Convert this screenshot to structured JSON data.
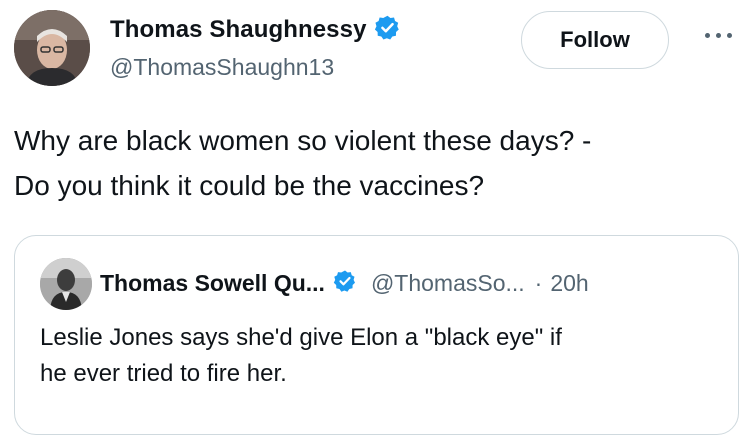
{
  "author": {
    "name": "Thomas Shaughnessy",
    "handle": "@ThomasShaughn13",
    "verified_color": "#1d9bf0"
  },
  "actions": {
    "follow_label": "Follow",
    "more_icon": "more-horizontal-icon"
  },
  "tweet": {
    "line1": "Why are black women so violent these days? -",
    "line2": "Do you think it could be the vaccines?"
  },
  "quote": {
    "name": "Thomas Sowell Qu...",
    "handle": "@ThomasSo...",
    "separator": "·",
    "time": "20h",
    "line1": "Leslie Jones says she'd give Elon a \"black eye\" if",
    "line2": "he ever tried to fire her."
  }
}
